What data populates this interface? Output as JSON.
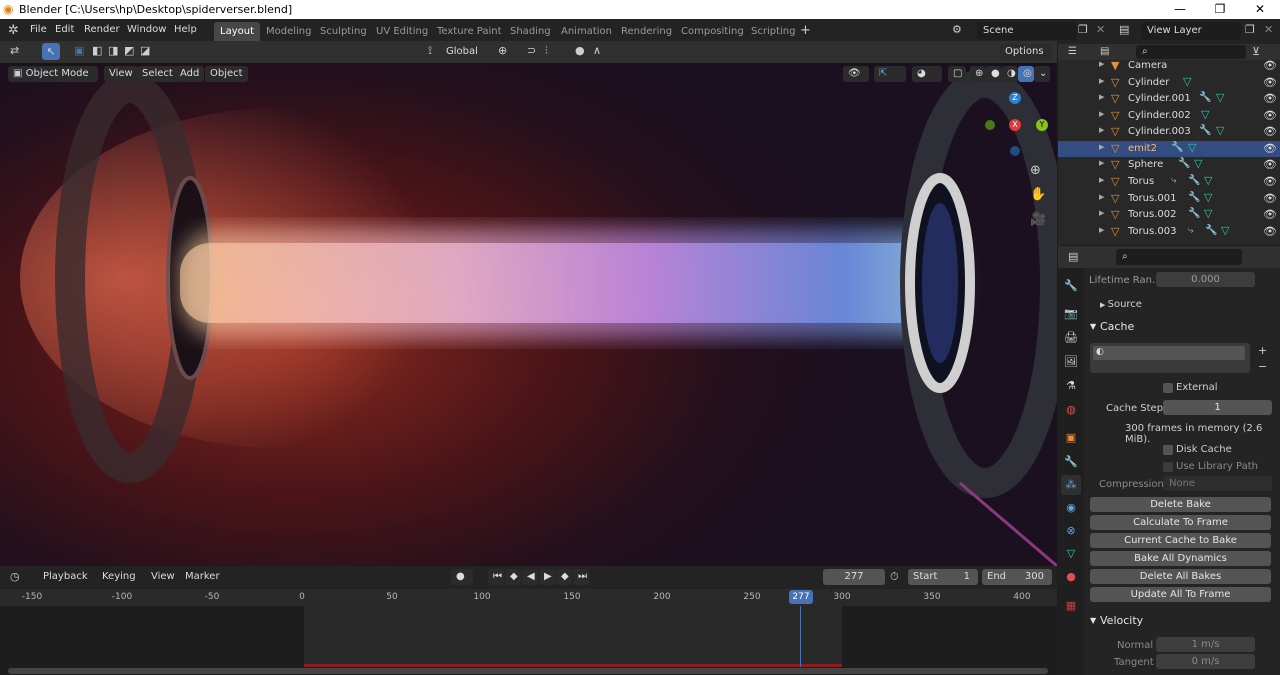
{
  "window": {
    "title": "Blender [C:\\Users\\hp\\Desktop\\spiderverser.blend]"
  },
  "menus": [
    "File",
    "Edit",
    "Render",
    "Window",
    "Help"
  ],
  "workspaces": [
    "Layout",
    "Modeling",
    "Sculpting",
    "UV Editing",
    "Texture Paint",
    "Shading",
    "Animation",
    "Rendering",
    "Compositing",
    "Scripting"
  ],
  "active_workspace": "Layout",
  "scene": {
    "name": "Scene",
    "view_layer": "View Layer"
  },
  "toolbar": {
    "orientation": "Global",
    "options": "Options"
  },
  "viewport_header": {
    "mode": "Object Mode",
    "view": "View",
    "select": "Select",
    "add": "Add",
    "object": "Object"
  },
  "outliner": {
    "items": [
      {
        "name": "Camera",
        "selected": false
      },
      {
        "name": "Cylinder",
        "selected": false
      },
      {
        "name": "Cylinder.001",
        "selected": false
      },
      {
        "name": "Cylinder.002",
        "selected": false
      },
      {
        "name": "Cylinder.003",
        "selected": false
      },
      {
        "name": "emit2",
        "selected": true
      },
      {
        "name": "Sphere",
        "selected": false
      },
      {
        "name": "Torus",
        "selected": false
      },
      {
        "name": "Torus.001",
        "selected": false
      },
      {
        "name": "Torus.002",
        "selected": false
      },
      {
        "name": "Torus.003",
        "selected": false
      }
    ]
  },
  "properties": {
    "lifetime_label": "Lifetime Ran...",
    "lifetime_value": "0.000",
    "source": "Source",
    "cache_header": "Cache",
    "external": "External",
    "cache_step_label": "Cache Step",
    "cache_step_value": "1",
    "memory_info": "300 frames in memory (2.6 MiB).",
    "disk_cache": "Disk Cache",
    "use_library_path": "Use Library Path",
    "compression_label": "Compression",
    "compression_value": "None",
    "buttons": [
      "Delete Bake",
      "Calculate To Frame",
      "Current Cache to Bake",
      "Bake All Dynamics",
      "Delete All Bakes",
      "Update All To Frame"
    ],
    "velocity_header": "Velocity",
    "normal_label": "Normal",
    "normal_value": "1 m/s",
    "tangent_label": "Tangent",
    "tangent_value": "0 m/s"
  },
  "timeline": {
    "playback": "Playback",
    "keying": "Keying",
    "view": "View",
    "marker": "Marker",
    "current_frame": "277",
    "start_label": "Start",
    "start": "1",
    "end_label": "End",
    "end": "300",
    "ticks": [
      "-150",
      "-100",
      "-50",
      "0",
      "50",
      "100",
      "150",
      "200",
      "250",
      "300",
      "350",
      "400"
    ],
    "playhead": "277"
  },
  "colors": {
    "accent": "#4772b3",
    "selected_row": "#334d80",
    "object_icon": "#e38f3c",
    "mesh_icon": "#2fc9a0"
  }
}
